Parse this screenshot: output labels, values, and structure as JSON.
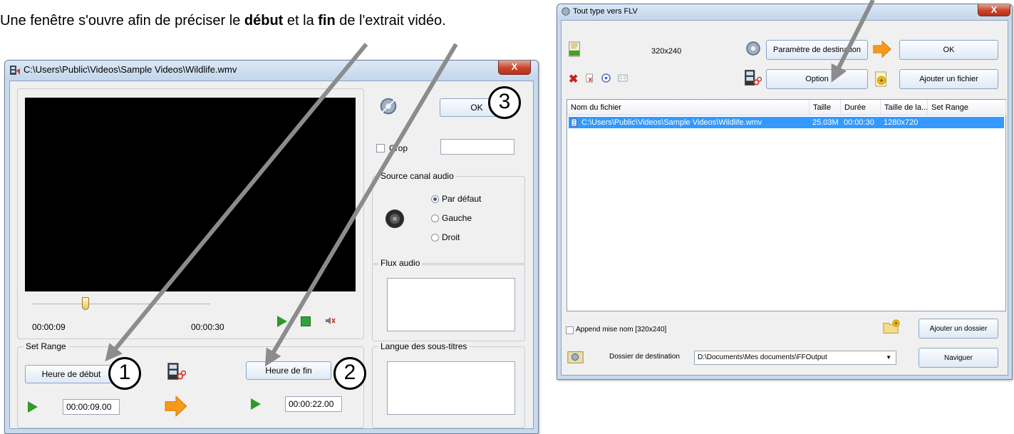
{
  "intro": {
    "part1": "Une fenêtre s'ouvre afin de préciser le ",
    "bold1": "début",
    "part2": " et la ",
    "bold2": "fin",
    "part3": " de l'extrait vidéo."
  },
  "left_window": {
    "title": "C:\\Users\\Public\\Videos\\Sample Videos\\Wildlife.wmv",
    "close_label": "X",
    "ok_label": "OK",
    "crop_label": "Crop",
    "crop_value": "",
    "audio_source": {
      "label": "Source canal audio",
      "options": [
        "Par défaut",
        "Gauche",
        "Droit"
      ],
      "selected": "Par défaut"
    },
    "audio_stream_label": "Flux audio",
    "subtitle_label": "Langue des sous-titres",
    "time_current": "00:00:09",
    "time_total": "00:00:30",
    "seek_fraction": 0.3,
    "set_range": {
      "label": "Set Range",
      "start_button": "Heure de début",
      "end_button": "Heure de fin",
      "start_value": "00:00:09.00",
      "end_value": "00:00:22.00"
    }
  },
  "right_window": {
    "title": "Tout type vers FLV",
    "close_label": "X",
    "resolution": "320x240",
    "dest_param_button": "Paramètre de destination",
    "ok_button": "OK",
    "option_button": "Option",
    "add_file_button": "Ajouter un fichier",
    "columns": [
      "Nom du fichier",
      "Taille",
      "Durée",
      "Taille de la...",
      "Set Range"
    ],
    "rows": [
      {
        "name": "C:\\Users\\Public\\Videos\\Sample Videos\\Wildlife.wmv",
        "size": "25.03M",
        "duration": "00:00:30",
        "dimensions": "1280x720",
        "range": ""
      }
    ],
    "append_name_label": "Append mise nom [320x240]",
    "add_folder_button": "Ajouter un dossier",
    "dest_folder_label": "Dossier de destination",
    "dest_folder_value": "D:\\Documents\\Mes documents\\FFOutput",
    "browse_button": "Naviguer"
  },
  "badges": [
    "1",
    "2",
    "3"
  ],
  "colors": {
    "play_green": "#2f9a28",
    "arrow_orange": "#f59a1a",
    "selection_blue": "#3399ff",
    "annotation_arrow": "#8c8c8c"
  },
  "icons": [
    "video-file-icon",
    "close-icon",
    "settings-gear-icon",
    "speaker-icon",
    "film-cut-icon",
    "play-icon",
    "stop-icon",
    "mute-icon",
    "orange-arrow-icon",
    "flv-file-icon",
    "delete-icon",
    "add-file-icon",
    "folder-add-icon",
    "folder-icon"
  ]
}
